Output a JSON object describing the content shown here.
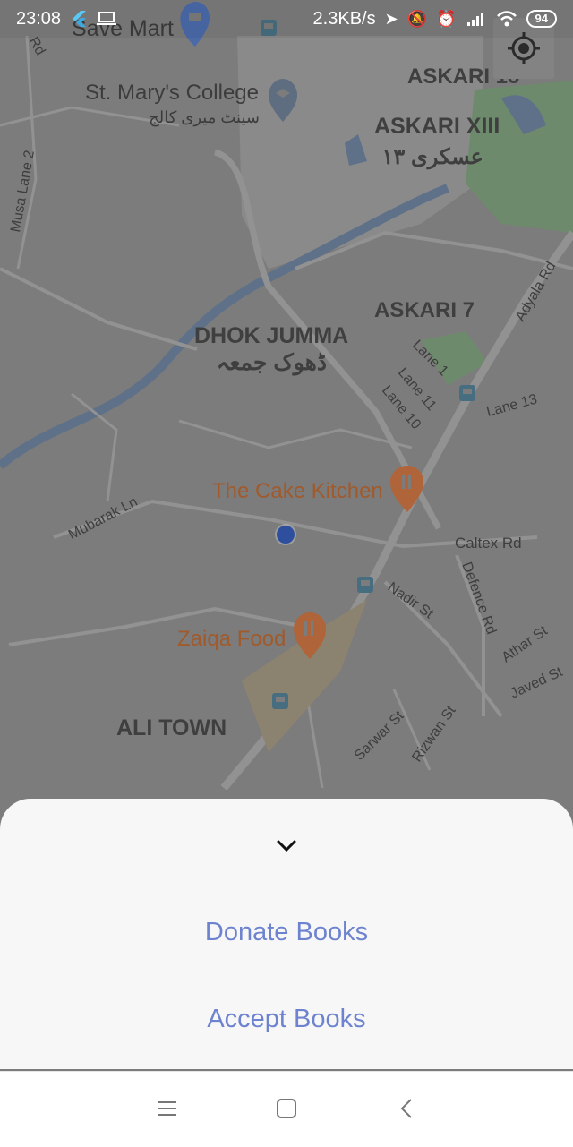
{
  "status_bar": {
    "time": "23:08",
    "network_speed": "2.3KB/s",
    "battery": "94"
  },
  "map": {
    "labels": {
      "save_mart": "Save Mart",
      "st_marys": "St. Mary's College",
      "st_marys_urdu": "سینٹ میری کالج",
      "askari13": "ASKARI 13",
      "askari_xiii": "ASKARI XIII",
      "askari_xiii_urdu": "عسکری ۱۳",
      "askari7": "ASKARI 7",
      "dhok_jumma": "DHOK JUMMA",
      "dhok_jumma_urdu": "ڈھوک جمعہ",
      "cake_kitchen": "The Cake Kitchen",
      "zaiqa_food": "Zaiqa Food",
      "ali_town": "ALI TOWN",
      "mubarak_ln": "Mubarak Ln",
      "caltex_rd": "Caltex Rd",
      "nadir_st": "Nadir St",
      "defence_rd": "Defence Rd",
      "athar_st": "Athar St",
      "javed_st": "Javed St",
      "sarwar_st": "Sarwar St",
      "rizwan_st": "Rizwan St",
      "adyala_rd": "Adyala Rd",
      "lane1": "Lane 1",
      "lane11": "Lane 11",
      "lane10": "Lane 10",
      "lane13": "Lane 13",
      "musa_lane2": "Musa Lane 2",
      "rd": "Rd"
    }
  },
  "sheet": {
    "donate_label": "Donate Books",
    "accept_label": "Accept Books"
  },
  "colors": {
    "accent": "#6e83cf",
    "map_overlay": "#7a7a7a"
  },
  "icons": {
    "collapse": "chevron-down-icon",
    "my_location": "my-location-icon",
    "nav_menu": "menu-icon",
    "nav_home": "home-icon",
    "nav_back": "back-icon"
  }
}
